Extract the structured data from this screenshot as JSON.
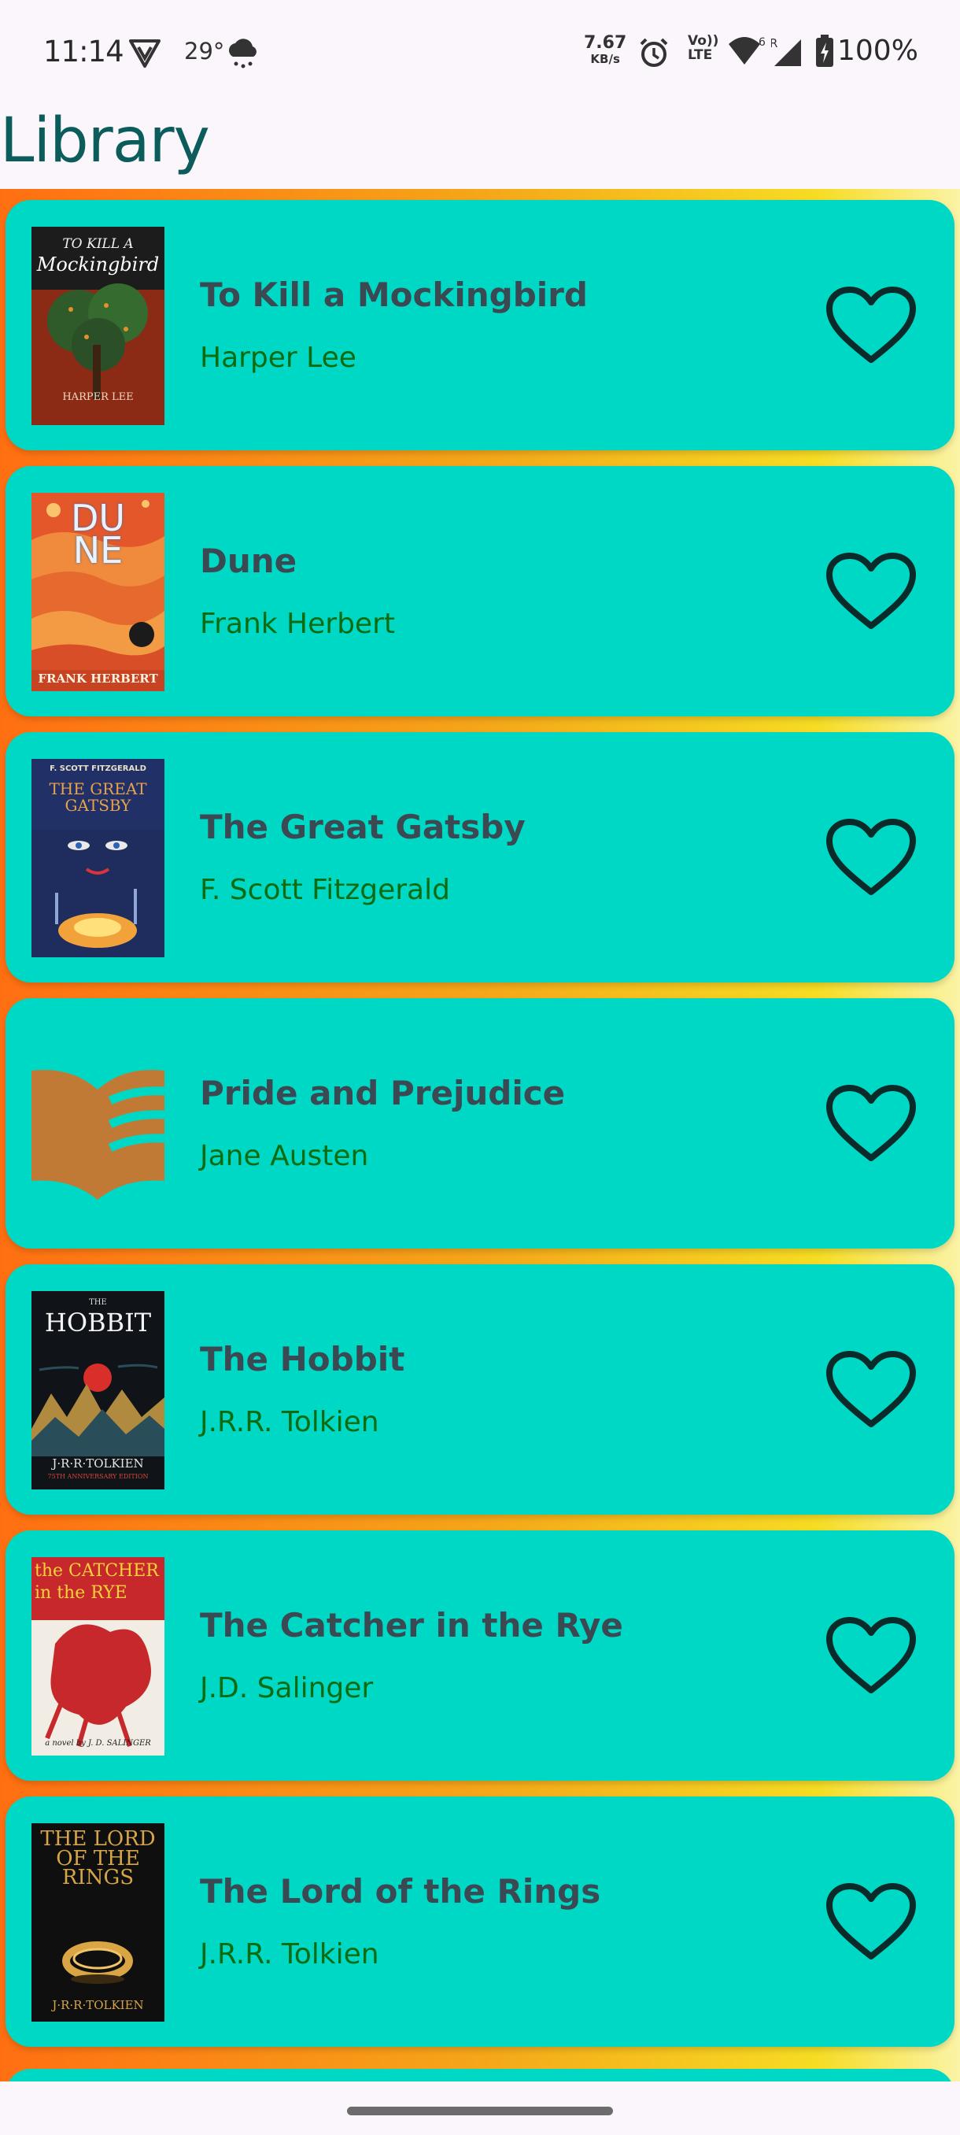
{
  "status_bar": {
    "time": "11:14",
    "temperature": "29°",
    "net_speed_value": "7.67",
    "net_speed_unit": "KB/s",
    "volte_line1": "Vo))",
    "volte_line2": "LTE",
    "wifi_badge": "6",
    "signal_badge": "R",
    "battery": "100%"
  },
  "header": {
    "title": "Library"
  },
  "books": [
    {
      "title": "To Kill a Mockingbird",
      "author": "Harper Lee",
      "cover_line1": "TO KILL A",
      "cover_line2": "Mockingbird",
      "cover_footer": "HARPER LEE",
      "favorite_icon": "heart-outline-icon",
      "is_favorite": false
    },
    {
      "title": "Dune",
      "author": "Frank Herbert",
      "cover_line1": "DUNE",
      "cover_footer": "FRANK HERBERT",
      "favorite_icon": "heart-outline-icon",
      "is_favorite": false
    },
    {
      "title": "The Great Gatsby",
      "author": "F. Scott Fitzgerald",
      "cover_line1": "F. SCOTT FITZGERALD",
      "cover_line2": "THE GREAT GATSBY",
      "favorite_icon": "heart-outline-icon",
      "is_favorite": false
    },
    {
      "title": "Pride and Prejudice",
      "author": "Jane Austen",
      "cover_icon": "open-book-icon",
      "favorite_icon": "heart-outline-icon",
      "is_favorite": false
    },
    {
      "title": "The Hobbit",
      "author": "J.R.R. Tolkien",
      "cover_line1": "THE",
      "cover_line2": "HOBBIT",
      "cover_footer": "J·R·R·TOLKIEN",
      "cover_subfooter": "75TH ANNIVERSARY EDITION",
      "favorite_icon": "heart-outline-icon",
      "is_favorite": false
    },
    {
      "title": "The Catcher in the Rye",
      "author": "J.D. Salinger",
      "cover_line1": "the CATCHER",
      "cover_line2": "in the RYE",
      "cover_footer": "a novel by J. D. SALINGER",
      "favorite_icon": "heart-outline-icon",
      "is_favorite": false
    },
    {
      "title": "The Lord of the Rings",
      "author": "J.R.R. Tolkien",
      "cover_line1": "THE LORD OF THE RINGS",
      "cover_footer": "J·R·R·TOLKIEN",
      "favorite_icon": "heart-outline-icon",
      "is_favorite": false
    }
  ],
  "colors": {
    "card": "#00d8c6",
    "title_text": "#3b4952",
    "author_text": "#0d6b10",
    "header_text": "#0b5c5b",
    "background_gradient": [
      "#ff6f12",
      "#f5a619",
      "#f6dc23",
      "#fbf3a6"
    ]
  }
}
